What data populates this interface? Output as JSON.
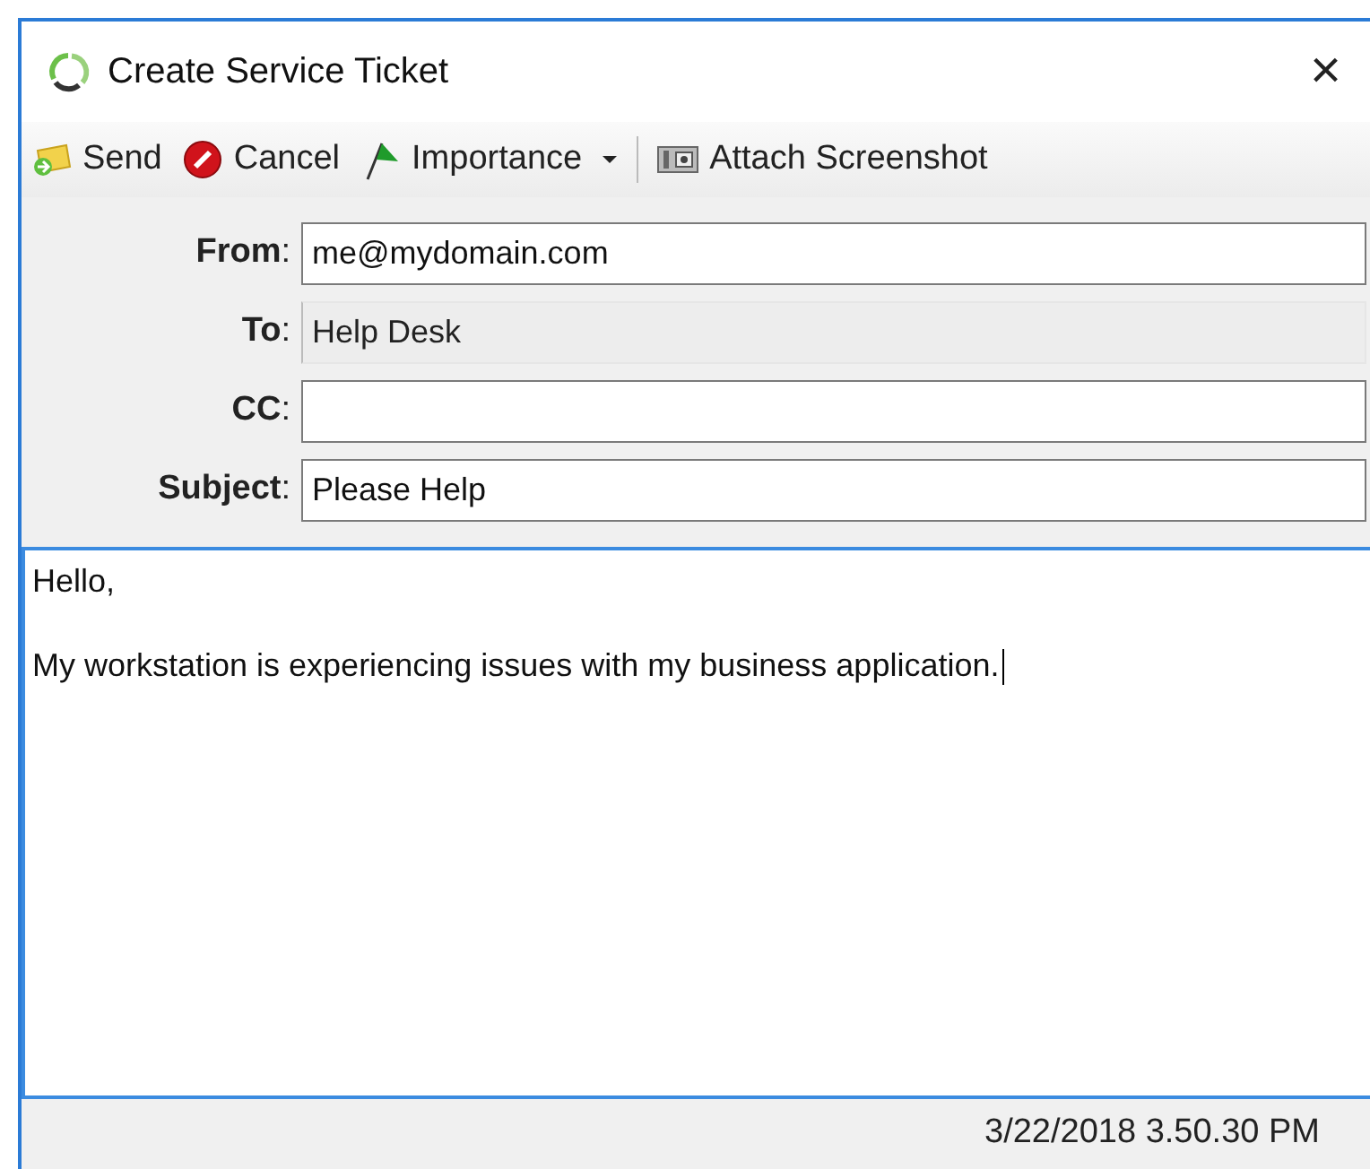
{
  "window": {
    "title": "Create Service Ticket",
    "close": "×"
  },
  "toolbar": [
    {
      "kind": "send",
      "label": "Send"
    },
    {
      "kind": "cancel",
      "label": "Cancel"
    },
    {
      "kind": "importance",
      "label": "Importance"
    },
    {
      "kind": "screenshot",
      "label": "Attach Screenshot"
    }
  ],
  "fields": [
    {
      "label": "**From**:",
      "value": "me@mydomain.com",
      "disabled": false
    },
    {
      "label": "**To**:",
      "value": "Help Desk",
      "disabled": true
    },
    {
      "label": "**CC**:",
      "disabled": false
    },
    {
      "label": "**Subject**:",
      "value": "Please Help",
      "disabled": false
    }
  ],
  "body": [
    "Hello,",
    "My workstation is experiencing issues with my business application."
  ],
  "status_bar": {
    "timestamp": "3/22/2018 3.50.30 PM"
  }
}
